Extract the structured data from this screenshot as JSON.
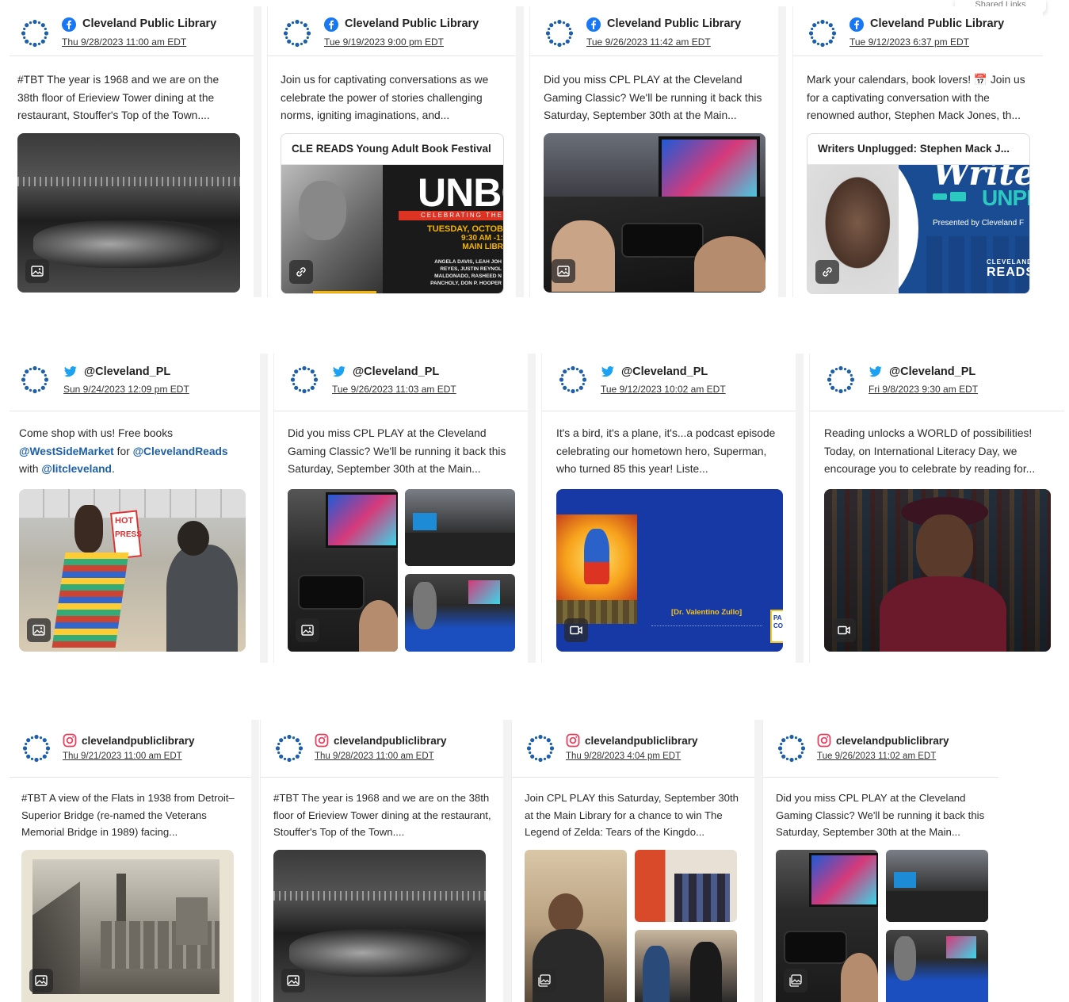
{
  "brand_colors": {
    "facebook": "#1877f2",
    "twitter": "#1da1f2",
    "instagram": "#e4405f",
    "mention": "#1d5fa8",
    "avatar": "#1d5fa8"
  },
  "corner_tag": "Shared Links",
  "posts": [
    {
      "platform": "facebook",
      "account": "Cleveland Public Library",
      "timestamp": "Thu 9/28/2023 11:00 am EDT",
      "text": "#TBT The year is 1968 and we are on the 38th floor of Erieview Tower dining at the restaurant, Stouffer's Top of the Town....",
      "media": "image-icon"
    },
    {
      "platform": "facebook",
      "account": "Cleveland Public Library",
      "timestamp": "Tue 9/19/2023 9:00 pm EDT",
      "text": "Join us for captivating conversations as we celebrate the power of stories challenging norms, igniting imaginations, and...",
      "link_title": "CLE READS Young Adult Book Festival",
      "poster": {
        "headline": "UNBO",
        "ribbon": "CELEBRATING THE F",
        "date": "TUESDAY, OCTOB",
        "time": "9:30 AM -1:",
        "place": "MAIN LIBR",
        "names": [
          "ANGELA DAVIS, LEAH JOH",
          "REYES, JUSTIN REYNOL",
          "MALDONADO, RASHEED N",
          "PANCHOLY, DON P. HOOPER"
        ]
      },
      "media": "link-icon"
    },
    {
      "platform": "facebook",
      "account": "Cleveland Public Library",
      "timestamp": "Tue 9/26/2023 11:42 am EDT",
      "text": "Did you miss CPL PLAY at the Cleveland Gaming Classic? We'll be running it back this Saturday, September 30th at the Main...",
      "media": "image-icon"
    },
    {
      "platform": "facebook",
      "account": "Cleveland Public Library",
      "timestamp": "Tue 9/12/2023 6:37 pm EDT",
      "text": "Mark your calendars, book lovers! 📅 Join us for a captivating conversation with the renowned author, Stephen Mack Jones, th...",
      "link_title": "Writers Unplugged: Stephen Mack J...",
      "poster": {
        "headline": "Write",
        "sub": "UNPL",
        "credit": "Presented by Cleveland F",
        "logo": "CLEVELAND",
        "logo2": "READS"
      },
      "media": "link-icon"
    },
    {
      "platform": "twitter",
      "account": "@Cleveland_PL",
      "timestamp": "Sun 9/24/2023 12:09 pm EDT",
      "text_parts": [
        "Come shop with us! Free books ",
        "@WestSideMarket",
        " for ",
        "@ClevelandReads",
        " with ",
        "@litcleveland",
        "."
      ],
      "sign1": "HOT",
      "sign2": "PRESS",
      "media": "image-icon"
    },
    {
      "platform": "twitter",
      "account": "@Cleveland_PL",
      "timestamp": "Tue 9/26/2023 11:03 am EDT",
      "text": "Did you miss CPL PLAY at the Cleveland Gaming Classic? We'll be running it back this Saturday, September 30th at the Main...",
      "media": "image-icon"
    },
    {
      "platform": "twitter",
      "account": "@Cleveland_PL",
      "timestamp": "Tue 9/12/2023 10:02 am EDT",
      "text": "It's a bird, it's a plane, it's...a podcast episode celebrating our hometown hero, Superman, who turned 85 this year! Liste...",
      "caption": "[Dr. Valentino Zullo]",
      "edge_text": "PA CO",
      "media": "video-icon"
    },
    {
      "platform": "twitter",
      "account": "@Cleveland_PL",
      "timestamp": "Fri 9/8/2023 9:30 am EDT",
      "text": "Reading unlocks a WORLD of possibilities! Today, on International Literacy Day, we encourage you to celebrate by reading for...",
      "media": "video-icon"
    },
    {
      "platform": "instagram",
      "account": "clevelandpubliclibrary",
      "timestamp": "Thu 9/21/2023 11:00 am EDT",
      "text": "#TBT A view of the Flats in 1938 from Detroit–Superior Bridge (re-named the Veterans Memorial Bridge in 1989) facing...",
      "media": "image-icon"
    },
    {
      "platform": "instagram",
      "account": "clevelandpubliclibrary",
      "timestamp": "Thu 9/28/2023 11:00 am EDT",
      "text": "#TBT The year is 1968 and we are on the 38th floor of Erieview Tower dining at the restaurant, Stouffer's Top of the Town....",
      "media": "image-icon"
    },
    {
      "platform": "instagram",
      "account": "clevelandpubliclibrary",
      "timestamp": "Thu 9/28/2023 4:04 pm EDT",
      "text": "Join CPL PLAY this Saturday, September 30th at the Main Library for a chance to win The Legend of Zelda: Tears of the Kingdo...",
      "media": "gallery-icon"
    },
    {
      "platform": "instagram",
      "account": "clevelandpubliclibrary",
      "timestamp": "Tue 9/26/2023 11:02 am EDT",
      "text": "Did you miss CPL PLAY at the Cleveland Gaming Classic? We'll be running it back this Saturday, September 30th at the Main...",
      "media": "gallery-icon"
    }
  ]
}
